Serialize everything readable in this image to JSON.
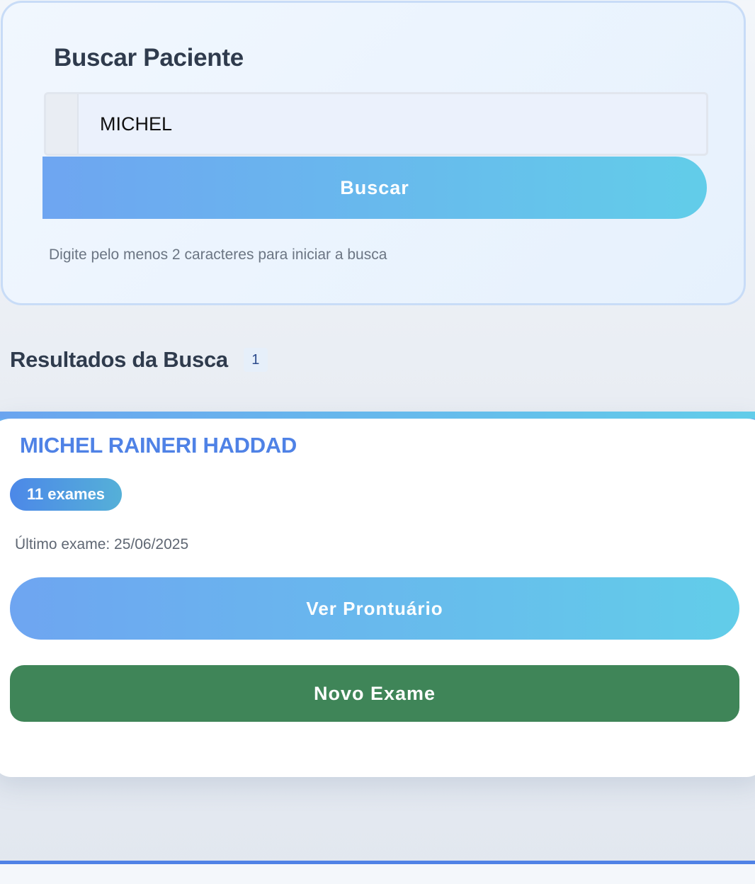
{
  "search": {
    "title": "Buscar Paciente",
    "input_value": "MICHEL",
    "button_label": "Buscar",
    "hint": "Digite pelo menos 2 caracteres para iniciar a busca"
  },
  "results": {
    "title": "Resultados da Busca",
    "count": "1",
    "patients": [
      {
        "name": "MICHEL RAINERI HADDAD",
        "exams_badge": "11 exames",
        "last_exam": "Último exame: 25/06/2025",
        "view_record_label": "Ver Prontuário",
        "new_exam_label": "Novo Exame"
      }
    ]
  },
  "colors": {
    "accent_blue": "#4f82e6",
    "gradient_start": "#6ea5f1",
    "gradient_end": "#62cde9",
    "new_exam_green": "#3f8558"
  }
}
